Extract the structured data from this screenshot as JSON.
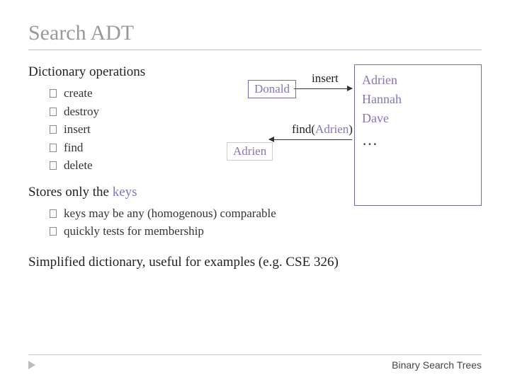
{
  "title": "Search ADT",
  "section1": {
    "heading": "Dictionary operations",
    "items": [
      "create",
      "destroy",
      "insert",
      "find",
      "delete"
    ]
  },
  "section2": {
    "lead": "Stores only the ",
    "accent": "keys",
    "items": [
      "keys may be any (homogenous) comparable",
      "quickly tests for membership"
    ]
  },
  "closing": "Simplified dictionary, useful for examples (e.g. CSE 326)",
  "diagram": {
    "box_items": [
      "Adrien",
      "Hannah",
      "Dave"
    ],
    "dots": "…",
    "donald": "Donald",
    "adrien_out": "Adrien",
    "insert_label": "insert",
    "find_label_pre": "find(",
    "find_arg": "Adrien",
    "find_label_post": ")"
  },
  "footer": "Binary Search Trees"
}
